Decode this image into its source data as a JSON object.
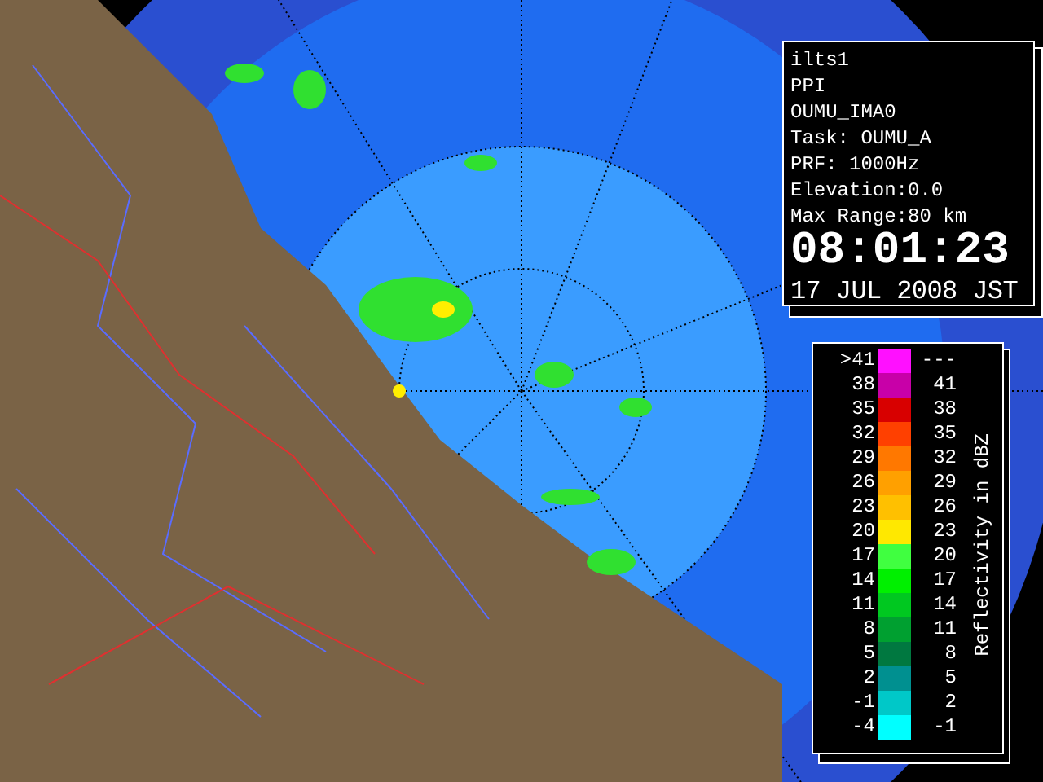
{
  "info": {
    "lines": [
      "ilts1",
      "PPI",
      "OUMU_IMA0",
      "Task: OUMU_A",
      "PRF: 1000Hz",
      "Elevation:0.0",
      "Max Range:80 km"
    ],
    "time": "08:01:23",
    "date": "17 JUL 2008 JST"
  },
  "legend": {
    "label": "Reflectivity in dBZ",
    "rows": [
      {
        "low": ">41",
        "high": "---",
        "color": "#ff10ff"
      },
      {
        "low": "38",
        "high": "41",
        "color": "#c800a8"
      },
      {
        "low": "35",
        "high": "38",
        "color": "#d80000"
      },
      {
        "low": "32",
        "high": "35",
        "color": "#ff4000"
      },
      {
        "low": "29",
        "high": "32",
        "color": "#ff7800"
      },
      {
        "low": "26",
        "high": "29",
        "color": "#ffa000"
      },
      {
        "low": "23",
        "high": "26",
        "color": "#ffc000"
      },
      {
        "low": "20",
        "high": "23",
        "color": "#ffe800"
      },
      {
        "low": "17",
        "high": "20",
        "color": "#40ff40"
      },
      {
        "low": "14",
        "high": "17",
        "color": "#00f000"
      },
      {
        "low": "11",
        "high": "14",
        "color": "#00c820"
      },
      {
        "low": "8",
        "high": "11",
        "color": "#00a030"
      },
      {
        "low": "5",
        "high": "8",
        "color": "#007840"
      },
      {
        "low": "2",
        "high": "5",
        "color": "#009090"
      },
      {
        "low": "-1",
        "high": "2",
        "color": "#00c8c8"
      },
      {
        "low": "-4",
        "high": "-1",
        "color": "#00ffff"
      }
    ]
  }
}
